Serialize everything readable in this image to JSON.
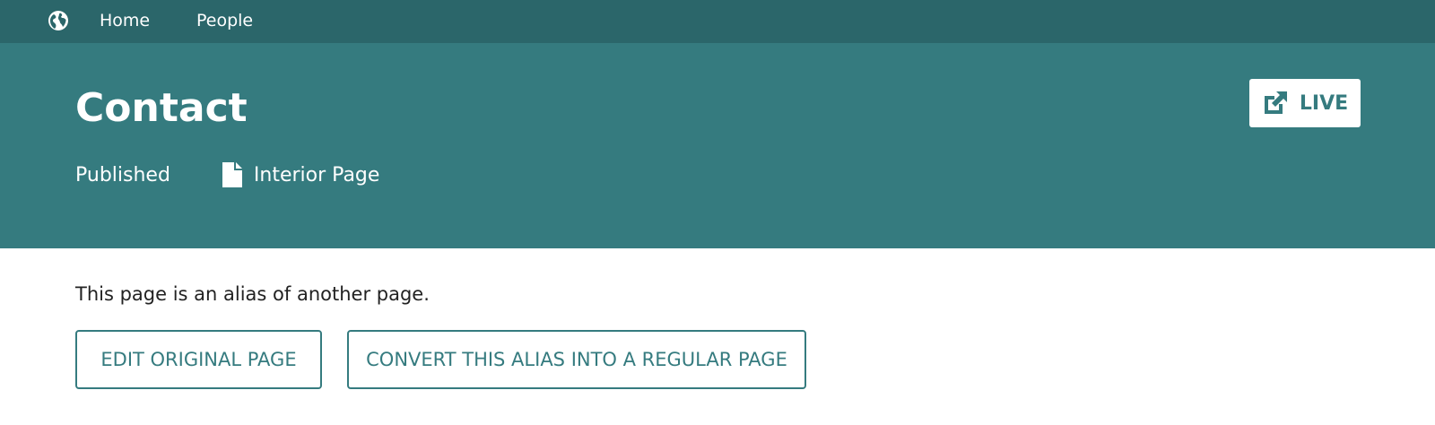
{
  "nav": {
    "logo_icon": "globe-icon",
    "items": [
      {
        "label": "Home"
      },
      {
        "label": "People"
      }
    ]
  },
  "header": {
    "title": "Contact",
    "status": "Published",
    "page_type": "Interior Page",
    "page_type_icon": "document-icon",
    "live_button": {
      "label": "LIVE",
      "icon": "external-link-icon"
    }
  },
  "main": {
    "alias_message": "This page is an alias of another page.",
    "edit_original_label": "EDIT ORIGINAL PAGE",
    "convert_label": "CONVERT THIS ALIAS INTO A REGULAR PAGE"
  },
  "colors": {
    "nav_bg": "#2b666a",
    "header_bg": "#357b7f",
    "accent": "#357b7f",
    "text": "#222222"
  }
}
